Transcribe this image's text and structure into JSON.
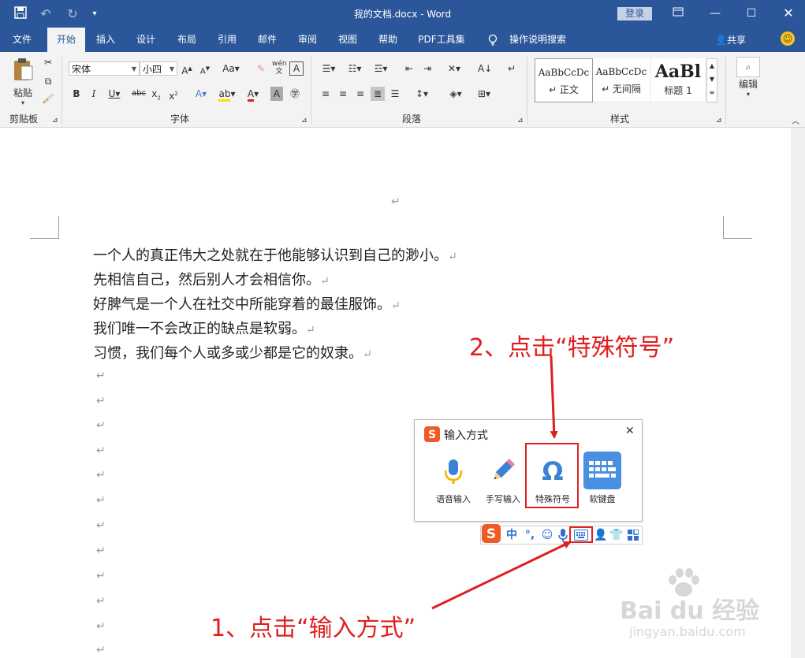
{
  "window": {
    "title": "我的文档.docx  -  Word",
    "login_label": "登录",
    "share_label": "共享"
  },
  "tabs": [
    "文件",
    "开始",
    "插入",
    "设计",
    "布局",
    "引用",
    "邮件",
    "审阅",
    "视图",
    "帮助",
    "PDF工具集",
    "操作说明搜索"
  ],
  "ribbon": {
    "clipboard": {
      "paste_label": "粘贴",
      "group_label": "剪贴板"
    },
    "font": {
      "family": "宋体",
      "size": "小四",
      "group_label": "字体"
    },
    "paragraph": {
      "group_label": "段落"
    },
    "styles": {
      "group_label": "样式",
      "items": [
        {
          "sample": "AaBbCcDc",
          "name": "↵ 正文"
        },
        {
          "sample": "AaBbCcDc",
          "name": "↵ 无间隔"
        },
        {
          "sample": "AaBl",
          "name": "标题 1"
        }
      ]
    },
    "editing": {
      "label": "编辑"
    }
  },
  "document": {
    "lines": [
      "一个人的真正伟大之处就在于他能够认识到自己的渺小。",
      "先相信自己，然后别人才会相信你。",
      "好脾气是一个人在社交中所能穿着的最佳服饰。",
      "我们唯一不会改正的缺点是软弱。",
      "习惯，我们每个人或多或少都是它的奴隶。"
    ],
    "paragraph_mark": "↵"
  },
  "ime_panel": {
    "title": "输入方式",
    "items": [
      {
        "label": "语音输入",
        "icon": "microphone-icon"
      },
      {
        "label": "手写输入",
        "icon": "pencil-icon"
      },
      {
        "label": "特殊符号",
        "icon": "omega-icon"
      },
      {
        "label": "软键盘",
        "icon": "keyboard-icon"
      }
    ]
  },
  "ime_toolbar": {
    "lang": "中",
    "punct": "°,"
  },
  "annotations": {
    "step1": "1、点击“输入方式”",
    "step2": "2、点击“特殊符号”"
  },
  "watermark": {
    "brand": "Bai du 经验",
    "url": "jingyan.baidu.com"
  },
  "colors": {
    "word_blue": "#2b579a",
    "annotation_red": "#e01e1e",
    "ime_orange": "#f05a24",
    "keyboard_blue": "#4a90e2"
  }
}
